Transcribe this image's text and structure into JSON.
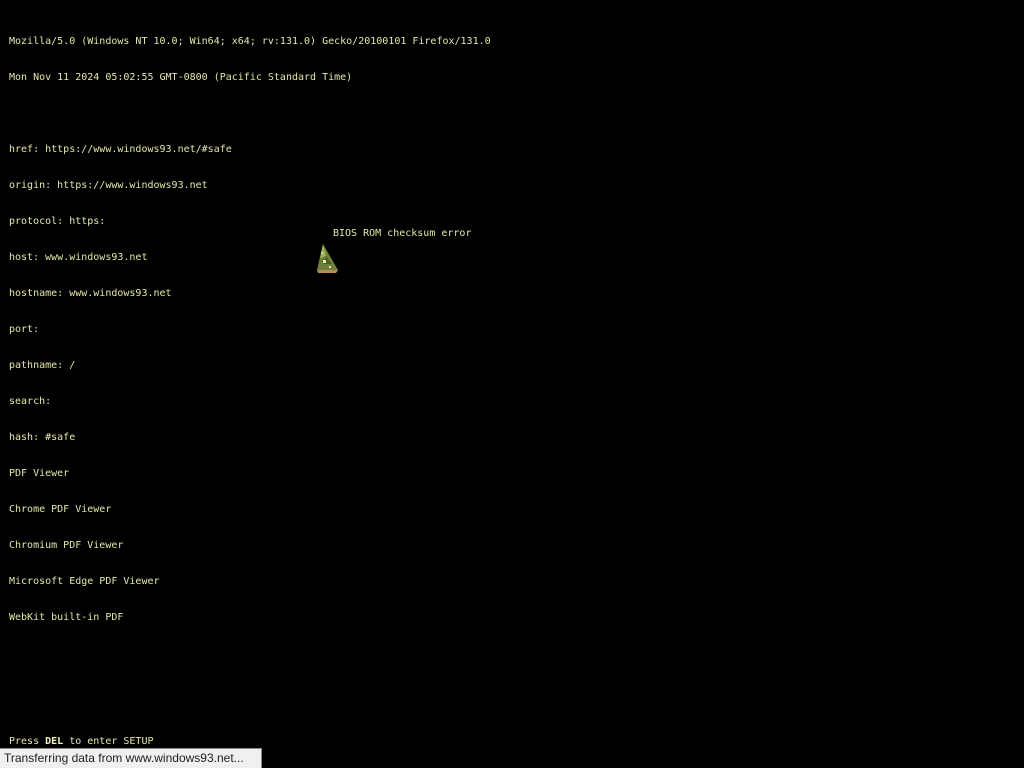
{
  "info": {
    "user_agent": "Mozilla/5.0 (Windows NT 10.0; Win64; x64; rv:131.0) Gecko/20100101 Firefox/131.0",
    "date": "Mon Nov 11 2024 05:02:55 GMT-0800 (Pacific Standard Time)",
    "location": [
      "href: https://www.windows93.net/#safe",
      "origin: https://www.windows93.net",
      "protocol: https:",
      "host: www.windows93.net",
      "hostname: www.windows93.net",
      "port:",
      "pathname: /",
      "search:",
      "hash: #safe"
    ],
    "plugins": [
      "PDF Viewer",
      "Chrome PDF Viewer",
      "Chromium PDF Viewer",
      "Microsoft Edge PDF Viewer",
      "WebKit built-in PDF"
    ]
  },
  "bios": {
    "error": "BIOS ROM checksum error"
  },
  "setup": {
    "prefix": "Press ",
    "key": "DEL",
    "suffix": " to enter SETUP"
  },
  "status": {
    "text": "Transferring data from www.windows93.net..."
  },
  "colors": {
    "background": "#000000",
    "text": "#e6e6a8",
    "status_bar_bg": "#f0f0f0"
  },
  "icons": {
    "sprite": "wizard-hat-icon"
  }
}
